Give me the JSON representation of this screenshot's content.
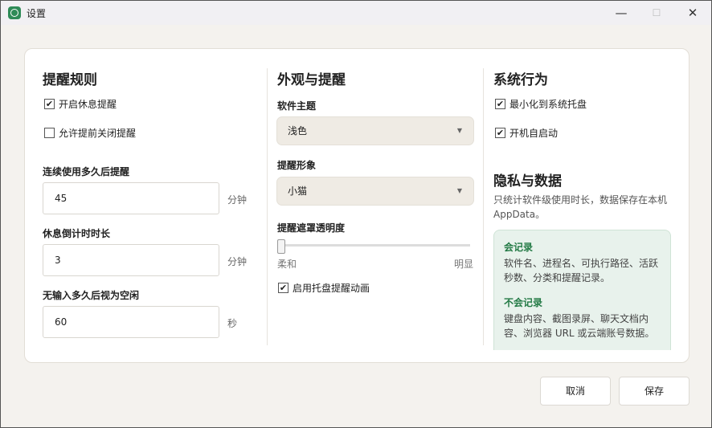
{
  "window": {
    "title": "设置",
    "minimize": "—",
    "maximize": "☐",
    "close": "✕"
  },
  "rules": {
    "heading": "提醒规则",
    "enable_break": {
      "label": "开启休息提醒",
      "checked": true
    },
    "allow_close": {
      "label": "允许提前关闭提醒",
      "checked": false
    },
    "fields": [
      {
        "label": "连续使用多久后提醒",
        "value": "45",
        "unit": "分钟"
      },
      {
        "label": "休息倒计时时长",
        "value": "3",
        "unit": "分钟"
      },
      {
        "label": "无输入多久后视为空闲",
        "value": "60",
        "unit": "秒"
      }
    ]
  },
  "appearance": {
    "heading": "外观与提醒",
    "theme_label": "软件主题",
    "theme_value": "浅色",
    "avatar_label": "提醒形象",
    "avatar_value": "小猫",
    "opacity_label": "提醒遮罩透明度",
    "opacity_value": 0,
    "opacity_min": "柔和",
    "opacity_max": "明显",
    "tray_anim": {
      "label": "启用托盘提醒动画",
      "checked": true
    }
  },
  "system": {
    "heading": "系统行为",
    "minimize_tray": {
      "label": "最小化到系统托盘",
      "checked": true
    },
    "autostart": {
      "label": "开机自启动",
      "checked": true
    }
  },
  "privacy": {
    "heading": "隐私与数据",
    "desc": "只统计软件级使用时长，数据保存在本机 AppData。",
    "records_title": "会记录",
    "records_text": "软件名、进程名、可执行路径、活跃秒数、分类和提醒记录。",
    "norecords_title": "不会记录",
    "norecords_text": "键盘内容、截图录屏、聊天文档内容、浏览器 URL 或云端账号数据。"
  },
  "footer": {
    "cancel": "取消",
    "save": "保存"
  },
  "check_mark": "✔"
}
